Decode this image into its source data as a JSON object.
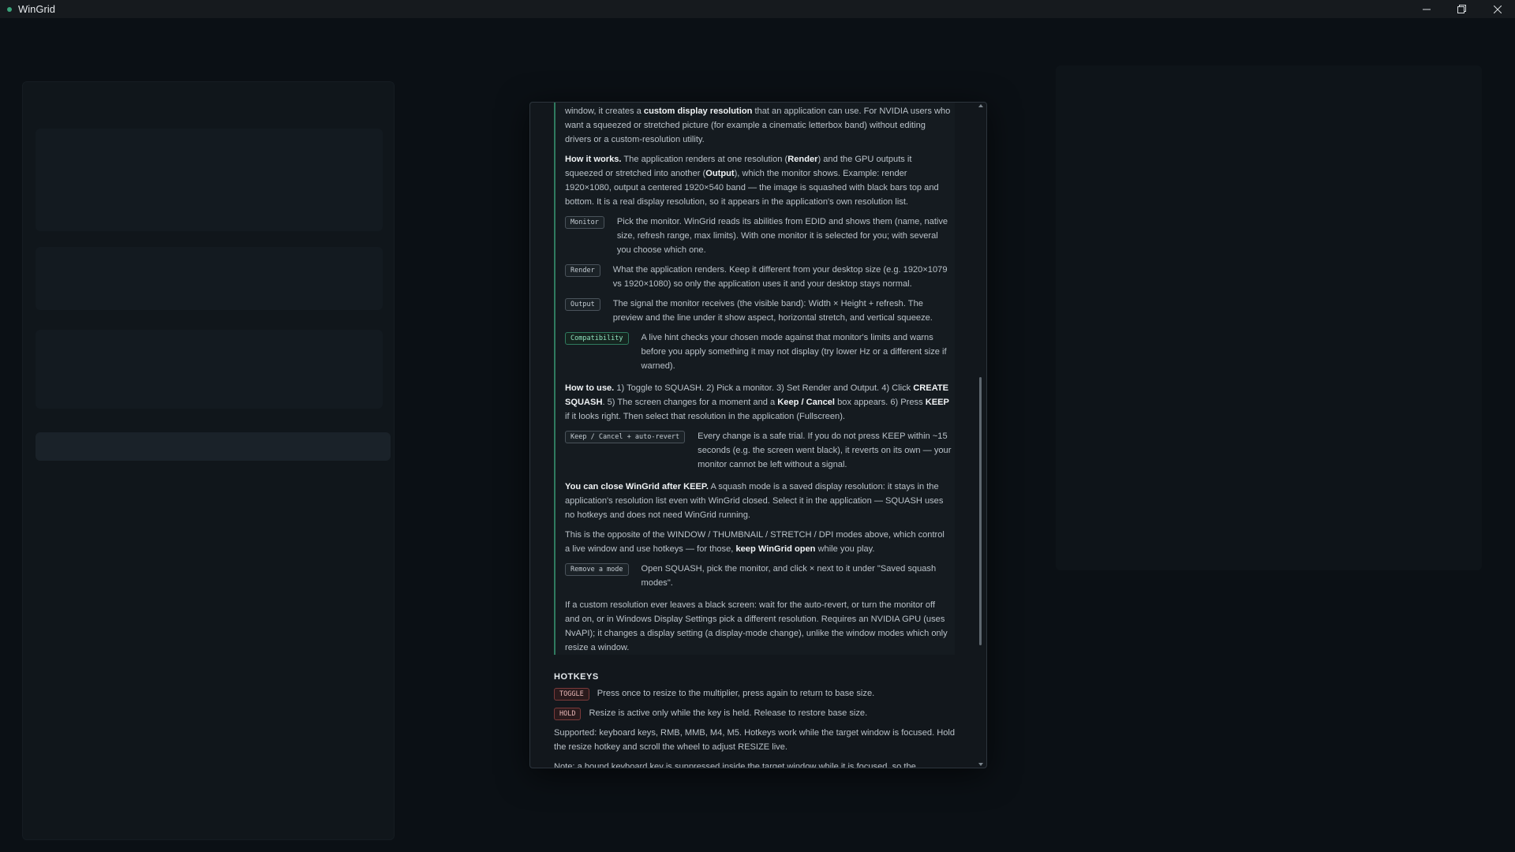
{
  "window": {
    "title": "WinGrid"
  },
  "intro_tail": {
    "t1": "window, it creates a ",
    "b1": "custom display resolution",
    "t2": " that an application can use. For NVIDIA users who want a squeezed or stretched picture (for example a cinematic letterbox band) without editing drivers or a custom-resolution utility."
  },
  "how_it_works": {
    "lead": "How it works.",
    "t1": " The application renders at one resolution (",
    "b1": "Render",
    "t2": ") and the GPU outputs it squeezed or stretched into another (",
    "b2": "Output",
    "t3": "), which the monitor shows. Example: render 1920×1080, output a centered 1920×540 band — the image is squashed with black bars top and bottom. It is a real display resolution, so it appears in the application's own resolution list."
  },
  "terms": [
    {
      "badge": "Monitor",
      "text": "Pick the monitor. WinGrid reads its abilities from EDID and shows them (name, native size, refresh range, max limits). With one monitor it is selected for you; with several you choose which one."
    },
    {
      "badge": "Render",
      "text": "What the application renders. Keep it different from your desktop size (e.g. 1920×1079 vs 1920×1080) so only the application uses it and your desktop stays normal."
    },
    {
      "badge": "Output",
      "text": "The signal the monitor receives (the visible band): Width × Height + refresh. The preview and the line under it show aspect, horizontal stretch, and vertical squeeze."
    },
    {
      "badge": "Compatibility",
      "text": "A live hint checks your chosen mode against that monitor's limits and warns before you apply something it may not display (try lower Hz or a different size if warned)."
    }
  ],
  "how_to_use": {
    "lead": "How to use.",
    "t1": " 1) Toggle to SQUASH. 2) Pick a monitor. 3) Set Render and Output. 4) Click ",
    "b1": "CREATE SQUASH",
    "t2": ". 5) The screen changes for a moment and a ",
    "b2": "Keep / Cancel",
    "t3": " box appears. 6) Press ",
    "b3": "KEEP",
    "t4": " if it looks right. Then select that resolution in the application (Fullscreen)."
  },
  "keep_cancel": {
    "badge": "Keep / Cancel + auto-revert",
    "text": "Every change is a safe trial. If you do not press KEEP within ~15 seconds (e.g. the screen went black), it reverts on its own — your monitor cannot be left without a signal."
  },
  "close_after": {
    "lead": "You can close WinGrid after KEEP.",
    "t1": " A squash mode is a saved display resolution: it stays in the application's resolution list even with WinGrid closed. Select it in the application — SQUASH uses no hotkeys and does not need WinGrid running."
  },
  "opposite": {
    "t1": "This is the opposite of the WINDOW / THUMBNAIL / STRETCH / DPI modes above, which control a live window and use hotkeys — for those, ",
    "b1": "keep WinGrid open",
    "t2": " while you play."
  },
  "remove_mode": {
    "badge": "Remove a mode",
    "text": "Open SQUASH, pick the monitor, and click × next to it under \"Saved squash modes\"."
  },
  "black_screen": "If a custom resolution ever leaves a black screen: wait for the auto-revert, or turn the monitor off and on, or in Windows Display Settings pick a different resolution. Requires an NVIDIA GPU (uses NvAPI); it changes a display setting (a display-mode change), unlike the window modes which only resize a window.",
  "hotkeys": {
    "title": "HOTKEYS",
    "toggle": {
      "badge": "TOGGLE",
      "text": "Press once to resize to the multiplier, press again to return to base size."
    },
    "hold": {
      "badge": "HOLD",
      "text": "Resize is active only while the key is held. Release to restore base size."
    },
    "supported": "Supported: keyboard keys, RMB, MMB, M4, M5. Hotkeys work while the target window is focused. Hold the resize hotkey and scroll the wheel to adjust RESIZE live.",
    "note": "Note: a bound keyboard key is suppressed inside the target window while it is focused, so the"
  },
  "colors": {
    "accent": "#2f7a5f",
    "accent_text": "#8fe0bd",
    "hold_badge": "#7b3a3a"
  }
}
